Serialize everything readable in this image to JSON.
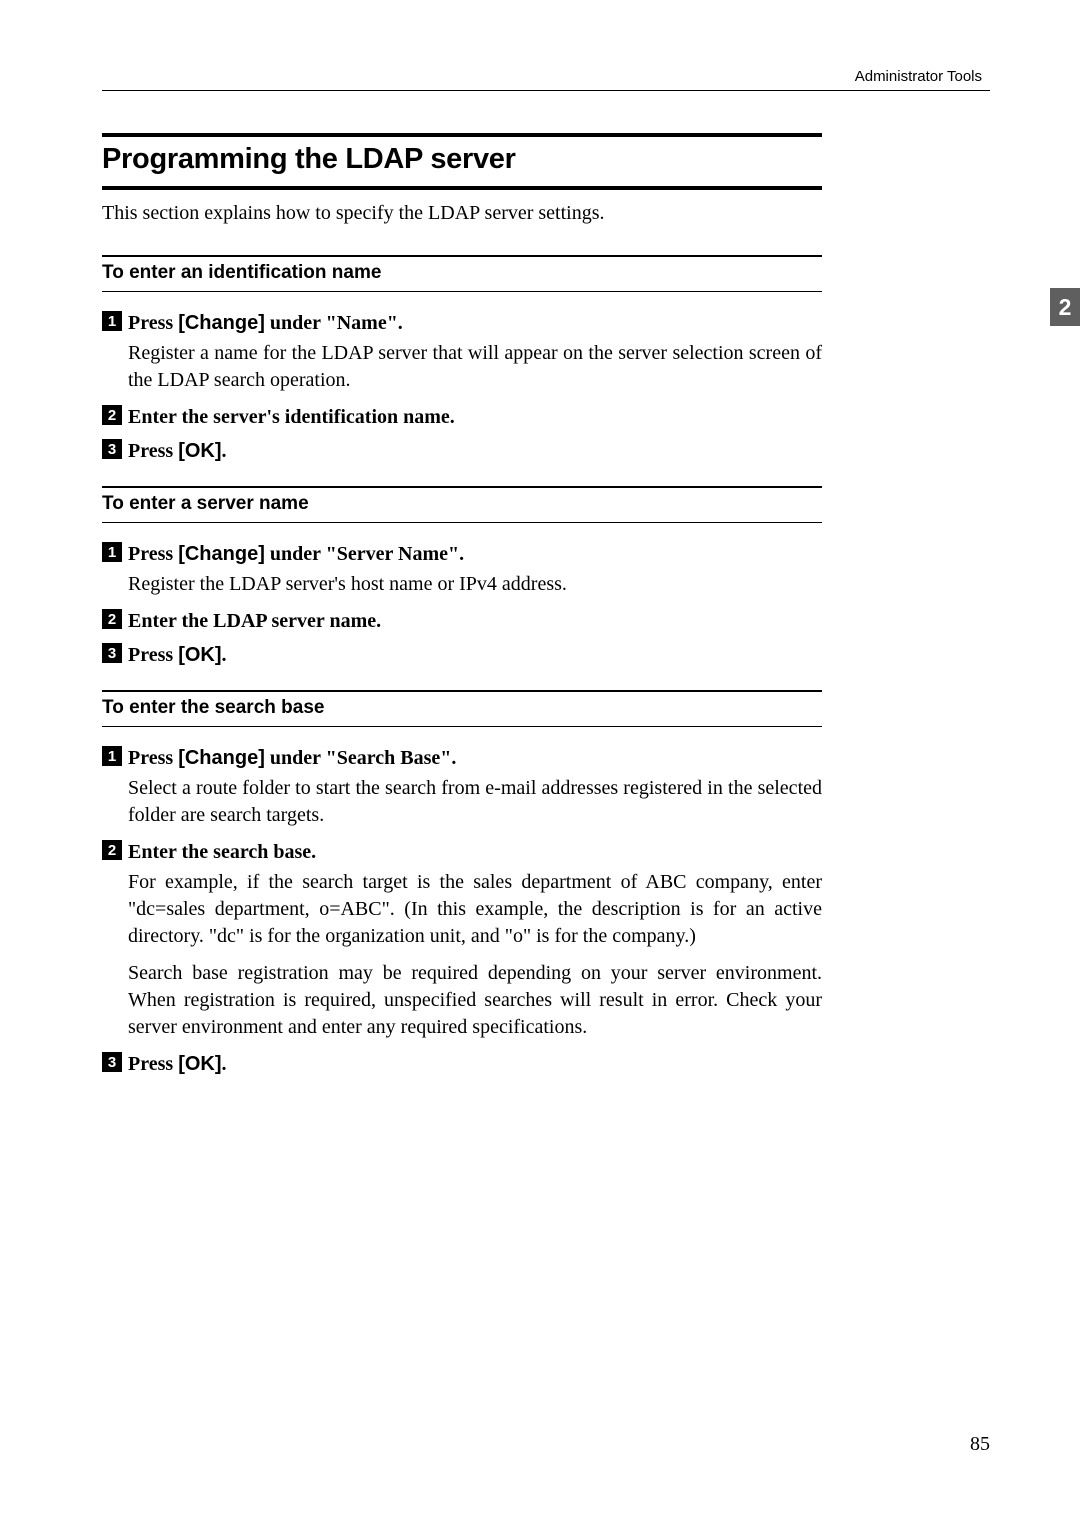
{
  "header": "Administrator Tools",
  "tab": "2",
  "title": "Programming the LDAP server",
  "intro": "This section explains how to specify the LDAP server settings.",
  "sections": [
    {
      "heading": "To enter an identification name",
      "steps": [
        {
          "num": "1",
          "prefix": "Press ",
          "button": "[Change]",
          "suffix": " under \"Name\".",
          "bodies": [
            "Register a name for the LDAP server that will appear on the server selection screen of the LDAP search operation."
          ]
        },
        {
          "num": "2",
          "text": "Enter the server's identification name.",
          "bodies": []
        },
        {
          "num": "3",
          "prefix": "Press ",
          "button": "[OK]",
          "suffix": ".",
          "bodies": []
        }
      ]
    },
    {
      "heading": "To enter a server name",
      "steps": [
        {
          "num": "1",
          "prefix": "Press ",
          "button": "[Change]",
          "suffix": " under \"Server Name\".",
          "bodies": [
            "Register the LDAP server's host name or IPv4 address."
          ]
        },
        {
          "num": "2",
          "text": "Enter the LDAP server name.",
          "bodies": []
        },
        {
          "num": "3",
          "prefix": "Press ",
          "button": "[OK]",
          "suffix": ".",
          "bodies": []
        }
      ]
    },
    {
      "heading": "To enter the search base",
      "steps": [
        {
          "num": "1",
          "prefix": "Press ",
          "button": "[Change]",
          "suffix": " under \"Search Base\".",
          "bodies": [
            "Select a route folder to start the search from e-mail addresses registered in the selected folder are search targets."
          ]
        },
        {
          "num": "2",
          "text": "Enter the search base.",
          "bodies": [
            "For example, if the search target is the sales department of ABC company, enter \"dc=sales department, o=ABC\". (In this example, the description is for an active directory. \"dc\" is for the organization unit, and \"o\" is for the company.)",
            "Search base registration may be required depending on your server environment. When registration is required, unspecified searches will result in error. Check your server environment and enter any required specifications."
          ]
        },
        {
          "num": "3",
          "prefix": "Press ",
          "button": "[OK]",
          "suffix": ".",
          "bodies": []
        }
      ]
    }
  ],
  "pageNumber": "85"
}
